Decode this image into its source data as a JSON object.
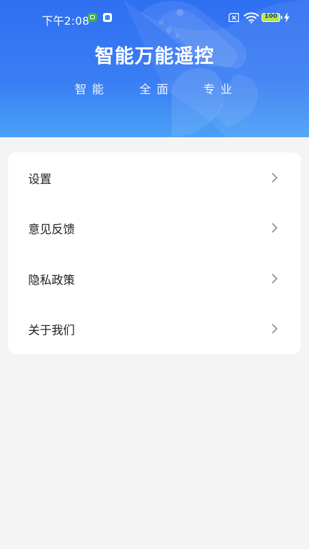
{
  "status_bar": {
    "time": "下午2:08",
    "battery": "100"
  },
  "header": {
    "title": "智能万能遥控",
    "tagline": [
      "智能",
      "全面",
      "专业"
    ]
  },
  "menu": {
    "items": [
      {
        "label": "设置",
        "icon": "chevron-right-icon"
      },
      {
        "label": "意见反馈",
        "icon": "chevron-right-icon"
      },
      {
        "label": "隐私政策",
        "icon": "chevron-right-icon"
      },
      {
        "label": "关于我们",
        "icon": "chevron-right-icon"
      }
    ]
  },
  "colors": {
    "header_blue": "#2f6ff2",
    "page_background": "#f4f4f4",
    "card_background": "#ffffff",
    "text_primary": "#1f1f1f",
    "chevron": "#8a8a8a"
  }
}
